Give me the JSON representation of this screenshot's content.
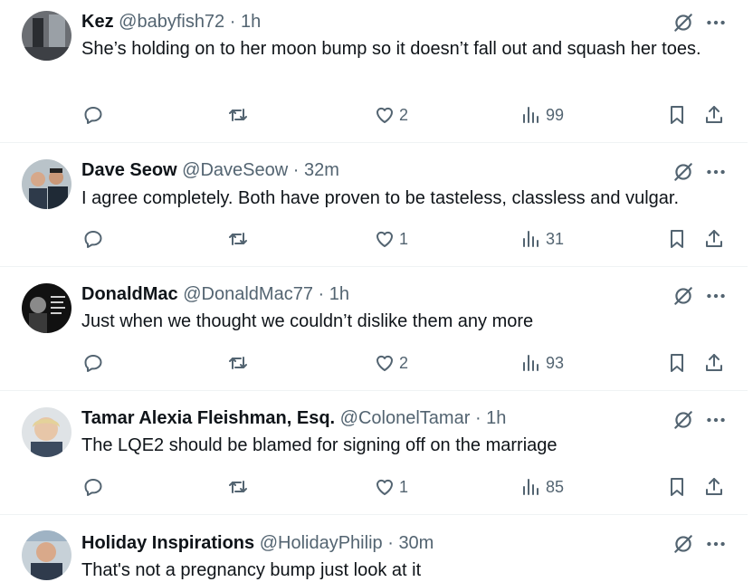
{
  "tweets": [
    {
      "name": "Kez",
      "handle": "@babyfish72",
      "separator": "·",
      "time": "1h",
      "text": "She’s holding on to her moon bump so it doesn’t fall out and squash her toes.",
      "likes": "2",
      "views": "99"
    },
    {
      "name": "Dave Seow",
      "handle": "@DaveSeow",
      "separator": "·",
      "time": "32m",
      "text": "I agree completely. Both have proven to be tasteless, classless and vulgar.",
      "likes": "1",
      "views": "31"
    },
    {
      "name": "DonaldMac",
      "handle": "@DonaldMac77",
      "separator": "·",
      "time": "1h",
      "text": "Just when we thought we couldn’t dislike them any more",
      "likes": "2",
      "views": "93"
    },
    {
      "name": "Tamar Alexia Fleishman, Esq.",
      "handle": "@ColonelTamar",
      "separator": "·",
      "time": "1h",
      "text": "The LQE2 should be blamed for signing off on the marriage",
      "likes": "1",
      "views": "85"
    },
    {
      "name": "Holiday Inspirations",
      "handle": "@HolidayPhilip",
      "separator": "·",
      "time": "30m",
      "text": "That's not a pregnancy bump just look at it",
      "likes": "",
      "views": ""
    }
  ],
  "colors": {
    "text": "#0f1419",
    "secondary": "#536471",
    "divider": "#eff3f4"
  }
}
